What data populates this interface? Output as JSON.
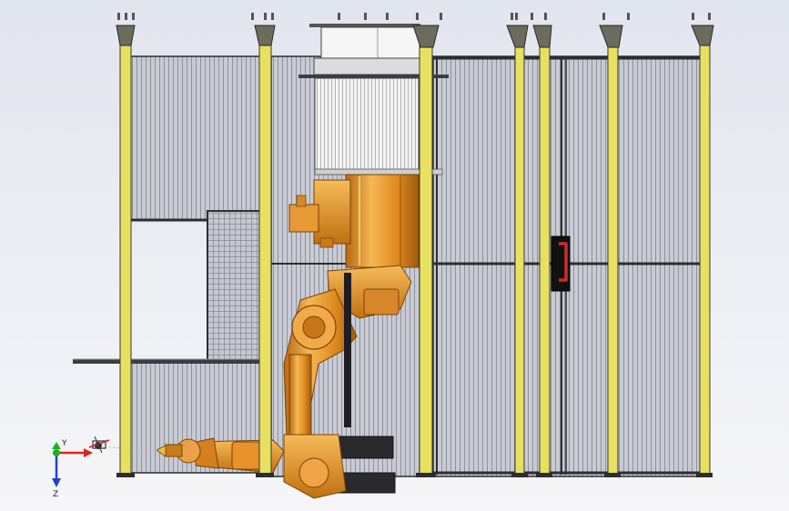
{
  "viewport": {
    "background_top": "#e2e5ef",
    "background_bottom": "#f6f6f8"
  },
  "colors": {
    "post_yellow": "#e8e060",
    "post_dark": "#3a3a2a",
    "mesh_fill": "#c7c9d2",
    "mesh_line": "#5d6068",
    "frame_dark": "#2b2d33",
    "robot_orange": "#e08a1e",
    "robot_orange_light": "#f4b24c",
    "robot_shadow": "#a35d0c",
    "handle_red": "#d22a2a",
    "drum_white": "#f2f2f2"
  },
  "triad": {
    "axis_y_label": "Y",
    "axis_z_label": "Z",
    "axis_x_color": "#e02020",
    "axis_y_color": "#20b020",
    "axis_z_color": "#2040d0"
  },
  "scene": {
    "components": [
      "safety-fence",
      "fence-posts",
      "access-door",
      "door-handle",
      "robot-base",
      "robot-lower-arm",
      "robot-upper-arm",
      "robot-wrist",
      "cable-drum",
      "roof-plate"
    ]
  }
}
